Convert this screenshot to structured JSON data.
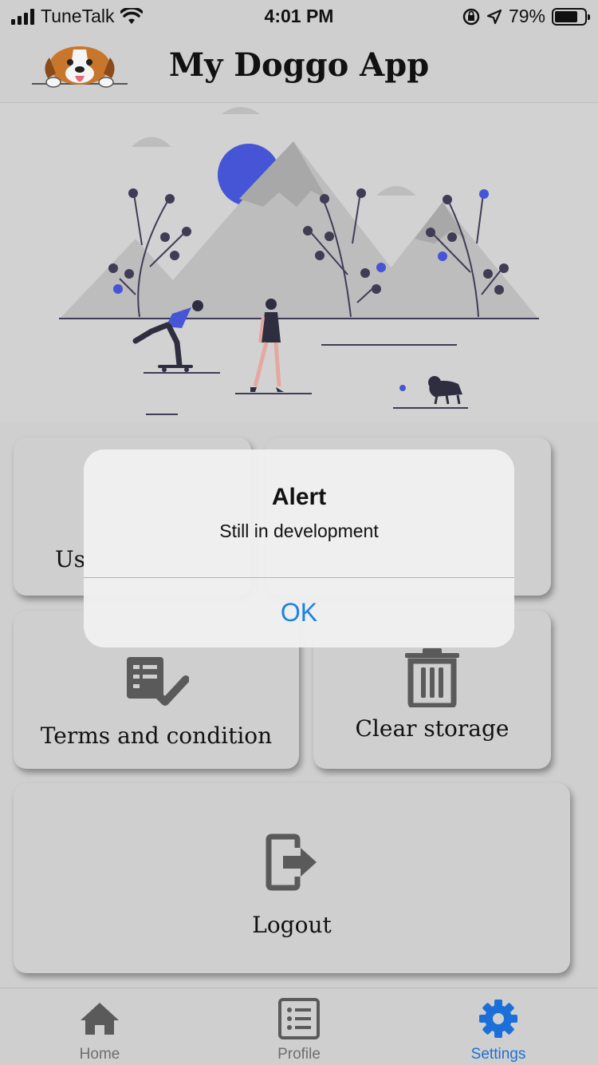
{
  "status_bar": {
    "carrier": "TuneTalk",
    "time": "4:01 PM",
    "battery_percent": "79%",
    "battery_level": 0.79,
    "icons": [
      "signal-icon",
      "wifi-icon",
      "rotation-lock-icon",
      "location-arrow-icon",
      "battery-icon"
    ]
  },
  "header": {
    "title": "My Doggo App",
    "logo_icon": "beagle-dog-logo-icon"
  },
  "cards": {
    "user": {
      "label_partial": "Us"
    },
    "terms": {
      "label": "Terms and condition",
      "icon": "checklist-icon"
    },
    "clear_storage": {
      "label": "Clear storage",
      "icon": "trash-icon"
    },
    "logout": {
      "label": "Logout",
      "icon": "logout-icon"
    }
  },
  "tab_bar": {
    "tabs": [
      {
        "label": "Home",
        "icon": "home-icon",
        "active": false
      },
      {
        "label": "Profile",
        "icon": "list-icon",
        "active": false
      },
      {
        "label": "Settings",
        "icon": "gear-icon",
        "active": true
      }
    ]
  },
  "alert": {
    "title": "Alert",
    "message": "Still in development",
    "button_label": "OK"
  },
  "colors": {
    "background": "#cfcfcf",
    "accent": "#1b82e6",
    "active_tab": "#1b6fd8",
    "illustration_blue": "#4555d6",
    "icon_gray": "#5a5a5a"
  }
}
